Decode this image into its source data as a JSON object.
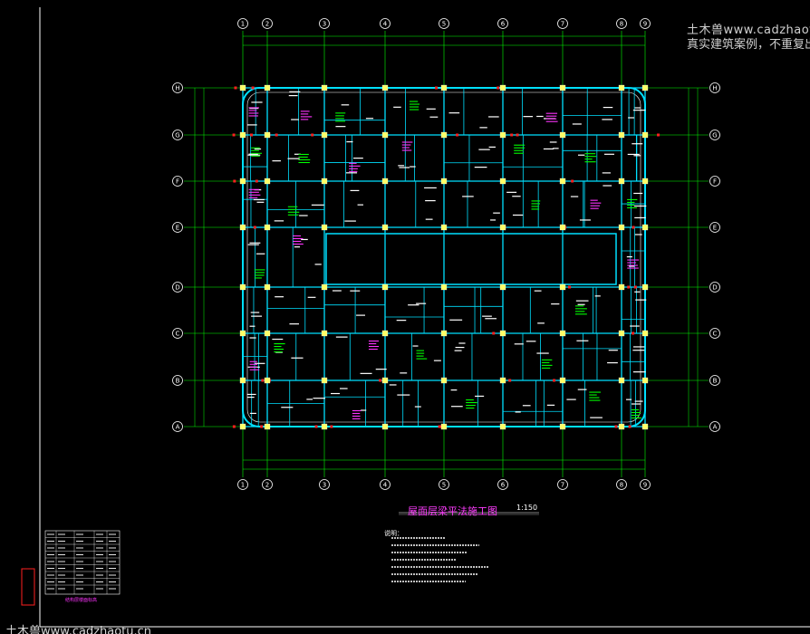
{
  "watermark": {
    "line1": "土木兽www.cadzhaotu.",
    "line2": "真实建筑案例，不重复出",
    "bottom": "土木兽www.cadzhaotu.cn"
  },
  "drawing": {
    "title": "屋面层梁平法施工图",
    "scale": "1:150",
    "notes_title": "说明："
  },
  "axes": {
    "numbered": [
      "1",
      "2",
      "3",
      "4",
      "5",
      "6",
      "7",
      "8",
      "9"
    ],
    "lettered": [
      "H",
      "G",
      "F",
      "E",
      "D",
      "C",
      "B",
      "A"
    ]
  },
  "colors": {
    "background": "#000000",
    "axis_grid": "#00ff00",
    "beams": "#00e0ff",
    "columns": "#ffff66",
    "annotation_green": "#00ff00",
    "annotation_magenta": "#ff33ff",
    "hatch_red": "#ff2020",
    "frame": "#ffffff"
  },
  "legend_table": {
    "label": "结构层楼面标高"
  }
}
